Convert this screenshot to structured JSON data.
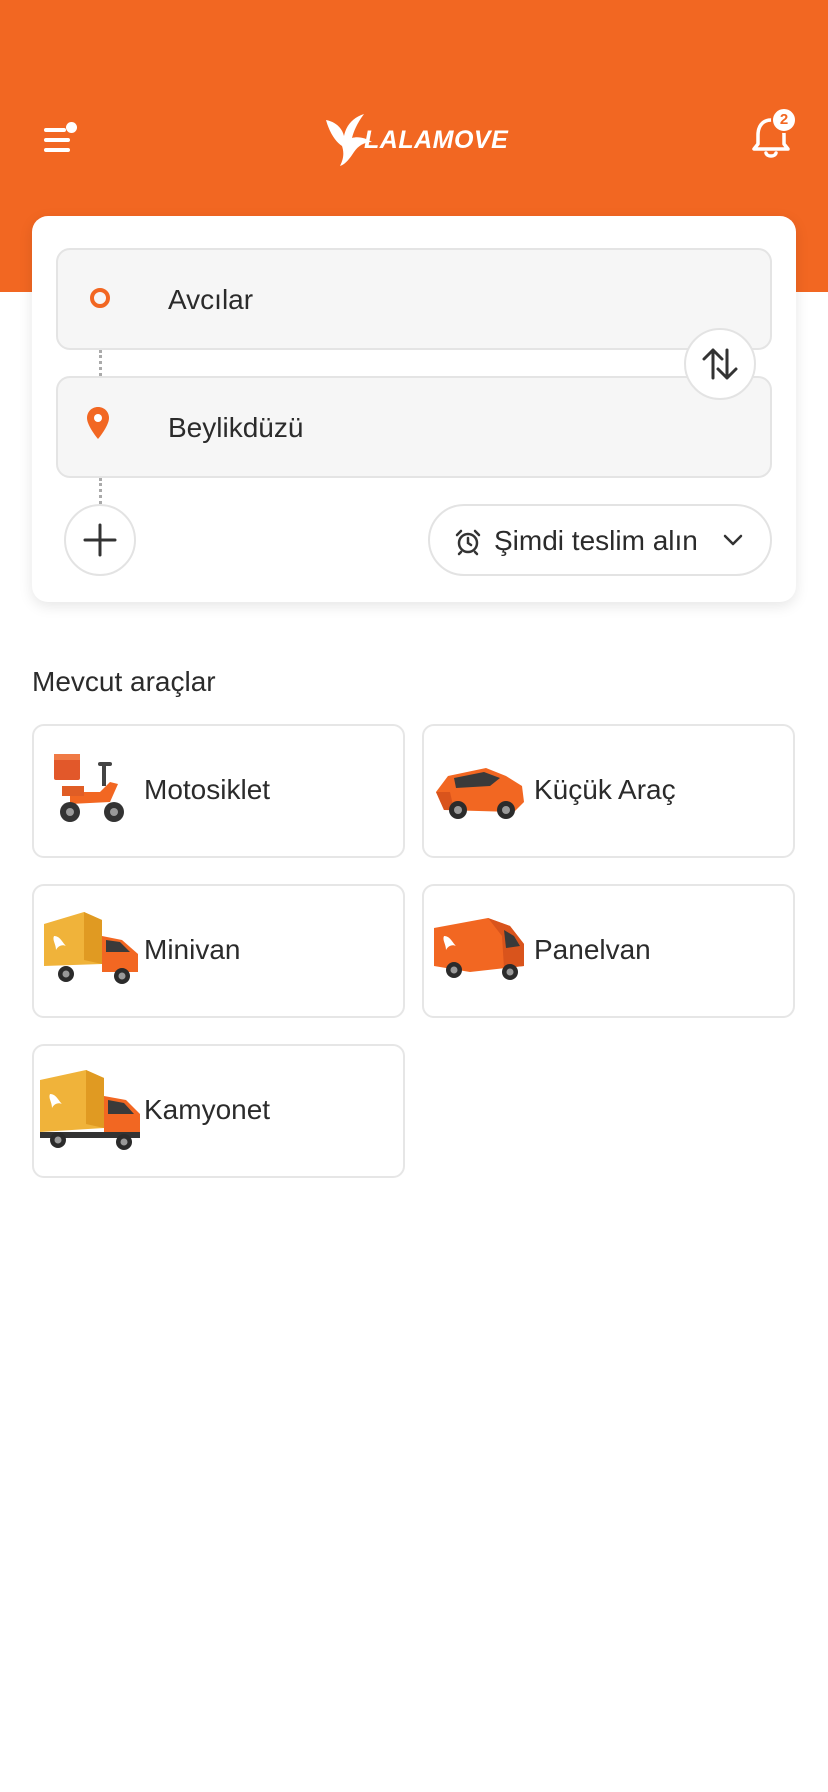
{
  "header": {
    "brand": "LALAMOVE",
    "notification_count": "2",
    "brand_color": "#f26722"
  },
  "route": {
    "pickup": "Avcılar",
    "dropoff": "Beylikdüzü",
    "pickup_icon": "origin-ring-icon",
    "dropoff_icon": "location-pin-icon",
    "swap_icon": "swap-arrows-icon",
    "add_icon": "plus-icon"
  },
  "schedule": {
    "label": "Şimdi teslim alın",
    "icon": "alarm-clock-icon"
  },
  "vehicles_section": {
    "title": "Mevcut araçlar",
    "items": [
      {
        "label": "Motosiklet",
        "icon": "motorcycle-icon"
      },
      {
        "label": "Küçük Araç",
        "icon": "car-icon"
      },
      {
        "label": "Minivan",
        "icon": "minivan-icon"
      },
      {
        "label": "Panelvan",
        "icon": "panel-van-icon"
      },
      {
        "label": "Kamyonet",
        "icon": "truck-icon"
      }
    ]
  }
}
